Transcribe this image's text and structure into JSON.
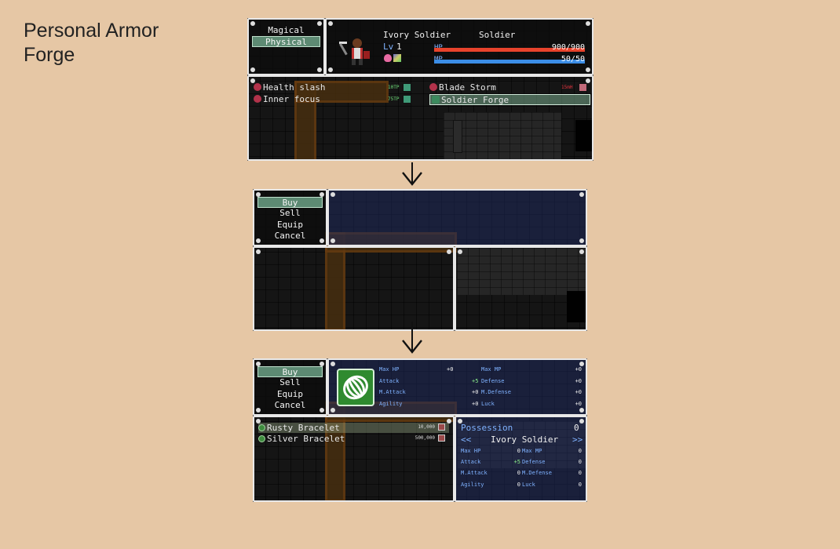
{
  "page_title": "Personal Armor Forge",
  "battle": {
    "skill_types": [
      "Magical",
      "Physical"
    ],
    "selected_type": "Physical",
    "actor": {
      "name": "Ivory Soldier",
      "class": "Soldier",
      "level_label": "Lv",
      "level": "1"
    },
    "hp": {
      "label": "HP",
      "value": "900/900",
      "ratio": 1.0
    },
    "mp": {
      "label": "MP",
      "value": "50/50",
      "ratio": 1.0
    },
    "skills": [
      {
        "name": "Health slash",
        "cost": "10TP"
      },
      {
        "name": "Inner focus",
        "cost": "75TP"
      },
      {
        "name": "Blade Storm",
        "cost": "15mH"
      },
      {
        "name": "Soldier Forge",
        "cost": ""
      }
    ],
    "selected_skill": "Soldier Forge"
  },
  "shop": {
    "commands": [
      "Buy",
      "Sell",
      "Equip",
      "Cancel"
    ],
    "selected_command": "Buy",
    "items": [
      {
        "name": "Rusty Bracelet",
        "price": "10,000"
      },
      {
        "name": "Silver Bracelet",
        "price": "500,000"
      }
    ],
    "selected_item": "Rusty Bracelet",
    "preview_stats": [
      {
        "label": "Max HP",
        "value": "+0"
      },
      {
        "label": "Max MP",
        "value": "+0"
      },
      {
        "label": "Attack",
        "value": "+5"
      },
      {
        "label": "Defense",
        "value": "+0"
      },
      {
        "label": "M.Attack",
        "value": "+0"
      },
      {
        "label": "M.Defense",
        "value": "+0"
      },
      {
        "label": "Agility",
        "value": "+0"
      },
      {
        "label": "Luck",
        "value": "+0"
      }
    ],
    "possession_label": "Possession",
    "possession_value": "0",
    "actor_nav_left": "<<",
    "actor_nav_right": ">>",
    "actor_name": "Ivory Soldier",
    "compare_stats": [
      {
        "label": "Max HP",
        "value": "0"
      },
      {
        "label": "Max MP",
        "value": "0"
      },
      {
        "label": "Attack",
        "value": "+5"
      },
      {
        "label": "Defense",
        "value": "0"
      },
      {
        "label": "M.Attack",
        "value": "0"
      },
      {
        "label": "M.Defense",
        "value": "0"
      },
      {
        "label": "Agility",
        "value": "0"
      },
      {
        "label": "Luck",
        "value": "0"
      }
    ]
  },
  "colors": {
    "background": "#e6c7a5",
    "hp": "#e8432c",
    "mp": "#3b8de6",
    "selected": "#5d8a73",
    "system_text": "#7fb2ff"
  }
}
